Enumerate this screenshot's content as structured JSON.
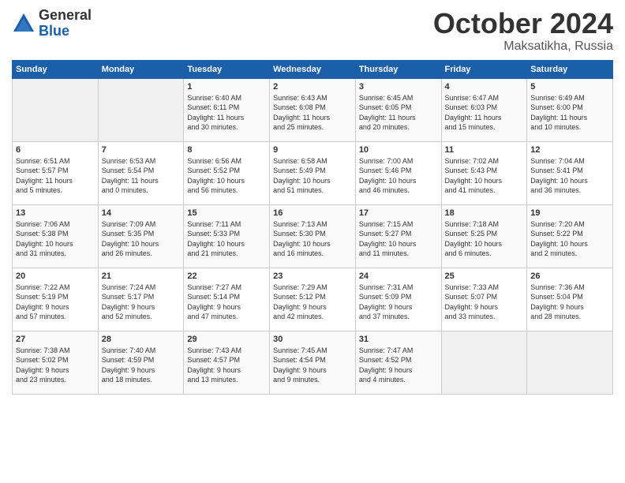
{
  "logo": {
    "general": "General",
    "blue": "Blue"
  },
  "title": "October 2024",
  "subtitle": "Maksatikha, Russia",
  "days_header": [
    "Sunday",
    "Monday",
    "Tuesday",
    "Wednesday",
    "Thursday",
    "Friday",
    "Saturday"
  ],
  "weeks": [
    [
      {
        "num": "",
        "detail": ""
      },
      {
        "num": "",
        "detail": ""
      },
      {
        "num": "1",
        "detail": "Sunrise: 6:40 AM\nSunset: 6:11 PM\nDaylight: 11 hours\nand 30 minutes."
      },
      {
        "num": "2",
        "detail": "Sunrise: 6:43 AM\nSunset: 6:08 PM\nDaylight: 11 hours\nand 25 minutes."
      },
      {
        "num": "3",
        "detail": "Sunrise: 6:45 AM\nSunset: 6:05 PM\nDaylight: 11 hours\nand 20 minutes."
      },
      {
        "num": "4",
        "detail": "Sunrise: 6:47 AM\nSunset: 6:03 PM\nDaylight: 11 hours\nand 15 minutes."
      },
      {
        "num": "5",
        "detail": "Sunrise: 6:49 AM\nSunset: 6:00 PM\nDaylight: 11 hours\nand 10 minutes."
      }
    ],
    [
      {
        "num": "6",
        "detail": "Sunrise: 6:51 AM\nSunset: 5:57 PM\nDaylight: 11 hours\nand 5 minutes."
      },
      {
        "num": "7",
        "detail": "Sunrise: 6:53 AM\nSunset: 5:54 PM\nDaylight: 11 hours\nand 0 minutes."
      },
      {
        "num": "8",
        "detail": "Sunrise: 6:56 AM\nSunset: 5:52 PM\nDaylight: 10 hours\nand 56 minutes."
      },
      {
        "num": "9",
        "detail": "Sunrise: 6:58 AM\nSunset: 5:49 PM\nDaylight: 10 hours\nand 51 minutes."
      },
      {
        "num": "10",
        "detail": "Sunrise: 7:00 AM\nSunset: 5:46 PM\nDaylight: 10 hours\nand 46 minutes."
      },
      {
        "num": "11",
        "detail": "Sunrise: 7:02 AM\nSunset: 5:43 PM\nDaylight: 10 hours\nand 41 minutes."
      },
      {
        "num": "12",
        "detail": "Sunrise: 7:04 AM\nSunset: 5:41 PM\nDaylight: 10 hours\nand 36 minutes."
      }
    ],
    [
      {
        "num": "13",
        "detail": "Sunrise: 7:06 AM\nSunset: 5:38 PM\nDaylight: 10 hours\nand 31 minutes."
      },
      {
        "num": "14",
        "detail": "Sunrise: 7:09 AM\nSunset: 5:35 PM\nDaylight: 10 hours\nand 26 minutes."
      },
      {
        "num": "15",
        "detail": "Sunrise: 7:11 AM\nSunset: 5:33 PM\nDaylight: 10 hours\nand 21 minutes."
      },
      {
        "num": "16",
        "detail": "Sunrise: 7:13 AM\nSunset: 5:30 PM\nDaylight: 10 hours\nand 16 minutes."
      },
      {
        "num": "17",
        "detail": "Sunrise: 7:15 AM\nSunset: 5:27 PM\nDaylight: 10 hours\nand 11 minutes."
      },
      {
        "num": "18",
        "detail": "Sunrise: 7:18 AM\nSunset: 5:25 PM\nDaylight: 10 hours\nand 6 minutes."
      },
      {
        "num": "19",
        "detail": "Sunrise: 7:20 AM\nSunset: 5:22 PM\nDaylight: 10 hours\nand 2 minutes."
      }
    ],
    [
      {
        "num": "20",
        "detail": "Sunrise: 7:22 AM\nSunset: 5:19 PM\nDaylight: 9 hours\nand 57 minutes."
      },
      {
        "num": "21",
        "detail": "Sunrise: 7:24 AM\nSunset: 5:17 PM\nDaylight: 9 hours\nand 52 minutes."
      },
      {
        "num": "22",
        "detail": "Sunrise: 7:27 AM\nSunset: 5:14 PM\nDaylight: 9 hours\nand 47 minutes."
      },
      {
        "num": "23",
        "detail": "Sunrise: 7:29 AM\nSunset: 5:12 PM\nDaylight: 9 hours\nand 42 minutes."
      },
      {
        "num": "24",
        "detail": "Sunrise: 7:31 AM\nSunset: 5:09 PM\nDaylight: 9 hours\nand 37 minutes."
      },
      {
        "num": "25",
        "detail": "Sunrise: 7:33 AM\nSunset: 5:07 PM\nDaylight: 9 hours\nand 33 minutes."
      },
      {
        "num": "26",
        "detail": "Sunrise: 7:36 AM\nSunset: 5:04 PM\nDaylight: 9 hours\nand 28 minutes."
      }
    ],
    [
      {
        "num": "27",
        "detail": "Sunrise: 7:38 AM\nSunset: 5:02 PM\nDaylight: 9 hours\nand 23 minutes."
      },
      {
        "num": "28",
        "detail": "Sunrise: 7:40 AM\nSunset: 4:59 PM\nDaylight: 9 hours\nand 18 minutes."
      },
      {
        "num": "29",
        "detail": "Sunrise: 7:43 AM\nSunset: 4:57 PM\nDaylight: 9 hours\nand 13 minutes."
      },
      {
        "num": "30",
        "detail": "Sunrise: 7:45 AM\nSunset: 4:54 PM\nDaylight: 9 hours\nand 9 minutes."
      },
      {
        "num": "31",
        "detail": "Sunrise: 7:47 AM\nSunset: 4:52 PM\nDaylight: 9 hours\nand 4 minutes."
      },
      {
        "num": "",
        "detail": ""
      },
      {
        "num": "",
        "detail": ""
      }
    ]
  ]
}
